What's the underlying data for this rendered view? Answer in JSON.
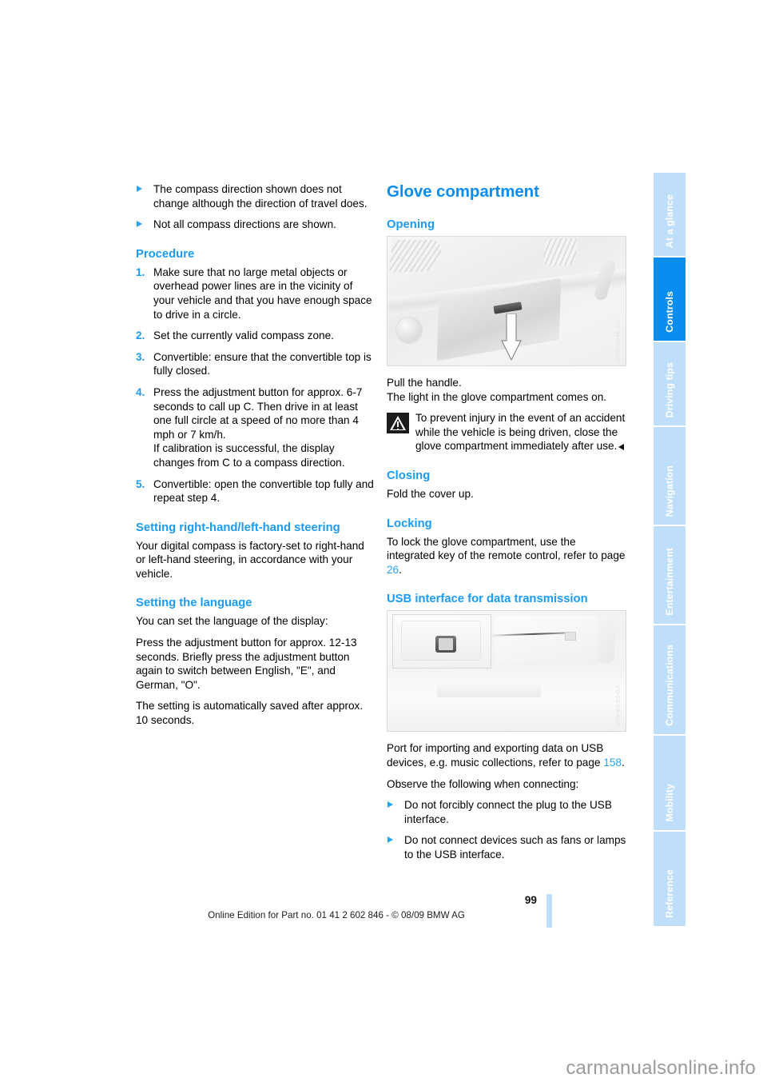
{
  "page": {
    "number": "99",
    "edition_line": "Online Edition for Part no. 01 41 2 602 846 - © 08/09 BMW AG",
    "watermark": "carmanualsonline.info",
    "accent_blue": "#0a8df0",
    "heading_blue": "#1a9bf5",
    "tab_inactive": "#bfdefa"
  },
  "tabs": [
    {
      "label": "At a glance",
      "active": false
    },
    {
      "label": "Controls",
      "active": true
    },
    {
      "label": "Driving tips",
      "active": false
    },
    {
      "label": "Navigation",
      "active": false
    },
    {
      "label": "Entertainment",
      "active": false
    },
    {
      "label": "Communications",
      "active": false
    },
    {
      "label": "Mobility",
      "active": false
    },
    {
      "label": "Reference",
      "active": false
    }
  ],
  "left_column": {
    "intro_bullets": [
      "The compass direction shown does not change although the direction of travel does.",
      "Not all compass directions are shown."
    ],
    "procedure_heading": "Procedure",
    "procedure_steps": [
      {
        "num": "1.",
        "text": "Make sure that no large metal objects or overhead power lines are in the vicinity of your vehicle and that you have enough space to drive in a circle."
      },
      {
        "num": "2.",
        "text": "Set the currently valid compass zone."
      },
      {
        "num": "3.",
        "text": "Convertible: ensure that the convertible top is fully closed."
      },
      {
        "num": "4.",
        "text": "Press the adjustment button for approx. 6-7 seconds to call up C. Then drive in at least one full circle at a speed of no more than 4 mph or 7 km/h.\nIf calibration is successful, the display changes from C to a compass direction."
      },
      {
        "num": "5.",
        "text": "Convertible: open the convertible top fully and repeat step 4."
      }
    ],
    "steering_heading": "Setting right-hand/left-hand steering",
    "steering_text": "Your digital compass is factory-set to right-hand or left-hand steering, in accordance with your vehicle.",
    "language_heading": "Setting the language",
    "language_intro": "You can set the language of the display:",
    "language_body": "Press the adjustment button for approx. 12-13 seconds. Briefly press the adjustment button again to switch between English, \"E\", and German, \"O\".",
    "language_save": "The setting is automatically saved after approx. 10 seconds."
  },
  "right_column": {
    "title": "Glove compartment",
    "opening_heading": "Opening",
    "glove_figure_watermark": "VD-04-06-AAN",
    "opening_line1": "Pull the handle.",
    "opening_line2": "The light in the glove compartment comes on.",
    "warning_text": "To prevent injury in the event of an accident while the vehicle is being driven, close the glove compartment immediately after use.",
    "closing_heading": "Closing",
    "closing_text": "Fold the cover up.",
    "locking_heading": "Locking",
    "locking_text_a": "To lock the glove compartment, use the integrated key of the remote control, refer to page ",
    "locking_page": "26",
    "locking_text_b": ".",
    "usb_heading": "USB interface for data transmission",
    "usb_figure_watermark": "VD-02-09-AAN",
    "usb_text_a": "Port for importing and exporting data on USB devices, e.g. music collections, refer to page ",
    "usb_page": "158",
    "usb_text_b": ".",
    "usb_observe": "Observe the following when connecting:",
    "usb_bullets": [
      "Do not forcibly connect the plug to the USB interface.",
      "Do not connect devices such as fans or lamps to the USB interface."
    ]
  }
}
